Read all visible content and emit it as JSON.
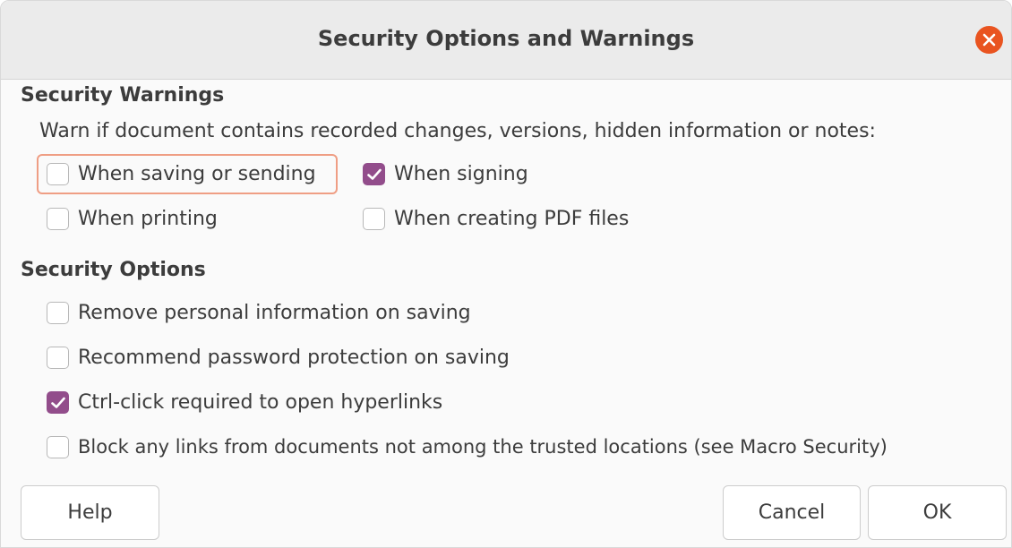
{
  "window": {
    "title": "Security Options and Warnings",
    "close_icon": "close-icon",
    "accent_color": "#e95420"
  },
  "security_warnings": {
    "heading": "Security Warnings",
    "description": "Warn if document contains recorded changes, versions, hidden information or notes:",
    "options": [
      {
        "label": "When saving or sending",
        "checked": false,
        "focused": true
      },
      {
        "label": "When signing",
        "checked": true
      },
      {
        "label": "When printing",
        "checked": false
      },
      {
        "label": "When creating PDF files",
        "checked": false
      }
    ]
  },
  "security_options": {
    "heading": "Security Options",
    "options": [
      {
        "label": "Remove personal information on saving",
        "checked": false
      },
      {
        "label": "Recommend password protection on saving",
        "checked": false
      },
      {
        "label": "Ctrl-click required to open hyperlinks",
        "checked": true
      },
      {
        "label": "Block any links from documents not among the trusted locations (see Macro Security)",
        "checked": false
      }
    ]
  },
  "buttons": {
    "help": "Help",
    "cancel": "Cancel",
    "ok": "OK"
  },
  "colors": {
    "checkbox_checked": "#924d8b",
    "focus_ring": "#ef9e84"
  }
}
